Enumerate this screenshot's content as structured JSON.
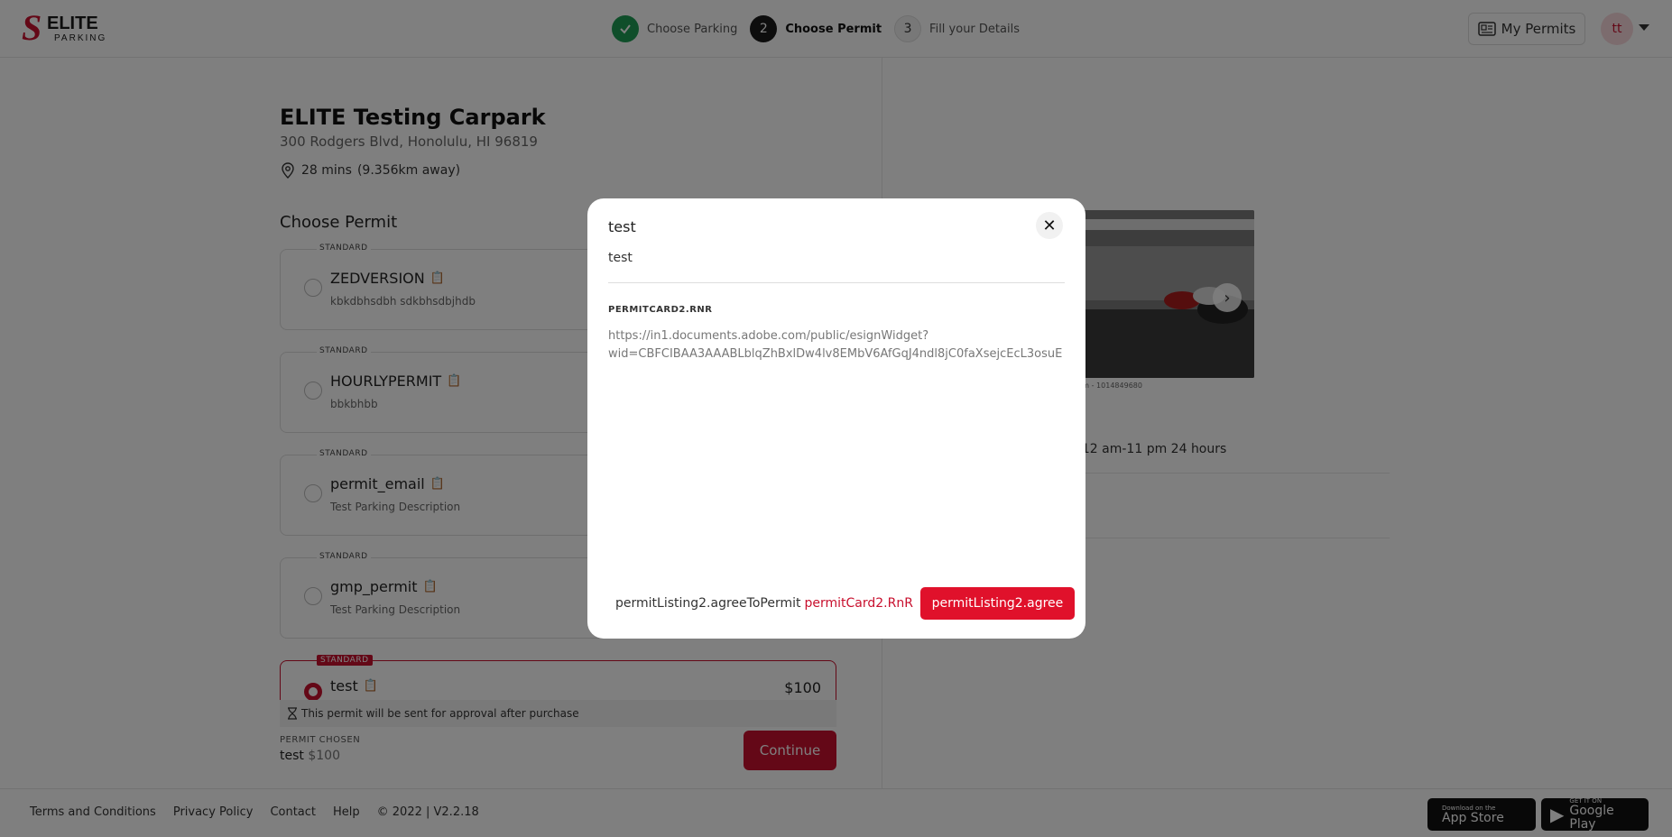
{
  "header": {
    "logo_text_primary": "ELITE",
    "logo_text_secondary": "PARKING",
    "steps": [
      {
        "number": "1",
        "label": "Choose Parking",
        "status": "done"
      },
      {
        "number": "2",
        "label": "Choose Permit",
        "status": "active"
      },
      {
        "number": "3",
        "label": "Fill your Details",
        "status": "todo"
      }
    ],
    "my_permits_label": "My Permits",
    "avatar_initials": "tt"
  },
  "carpark": {
    "name": "ELITE Testing Carpark",
    "address": "300 Rodgers Blvd, Honolulu, HI 96819",
    "duration": "28 mins",
    "distance": "(9.356km away)"
  },
  "choose_permit_title": "Choose Permit",
  "permits": [
    {
      "tag": "STANDARD",
      "name": "ZEDVERSION",
      "description": "kbkdbhsdbh sdkbhsdbjhdb",
      "price": "",
      "selected": false
    },
    {
      "tag": "STANDARD",
      "name": "HOURLYPERMIT",
      "description": "bbkbhbb",
      "price": "",
      "selected": false
    },
    {
      "tag": "STANDARD",
      "name": "permit_email",
      "description": "Test Parking Description",
      "price": "",
      "selected": false
    },
    {
      "tag": "STANDARD",
      "name": "gmp_permit",
      "description": "Test Parking Description",
      "price": "",
      "selected": false
    },
    {
      "tag": "STANDARD",
      "name": "test",
      "description": "",
      "price": "$100",
      "selected": true
    }
  ],
  "approval_notice": "This permit will be sent for approval after purchase",
  "permit_chosen": {
    "label": "PERMIT CHOSEN",
    "name": "test",
    "price": "$100"
  },
  "continue_label": "Continue",
  "side_panel": {
    "photo_credit": "com - 1014849680",
    "hours_text": ", 12 am-11 pm 24 hours"
  },
  "footer": {
    "links": [
      "Terms and Conditions",
      "Privacy Policy",
      "Contact",
      "Help"
    ],
    "copyright": "© 2022 | V2.2.18",
    "app_store": {
      "small": "Download on the",
      "big": "App Store"
    },
    "google_play": {
      "small": "GET IT ON",
      "big": "Google Play"
    }
  },
  "modal": {
    "title": "test",
    "subtitle": "test",
    "section_label": "PERMITCARD2.RNR",
    "url_line1": "https://in1.documents.adobe.com/public/esignWidget?",
    "url_line2": "wid=CBFCIBAA3AAABLblqZhBxlDw4lv8EMbV6AfGqJ4ndl8jC0faXsejcEcL3osuE",
    "agree_text": "permitListing2.agreeToPermit",
    "agree_link": "permitCard2.RnR",
    "agree_button": "permitListing2.agree"
  },
  "colors": {
    "brand_red": "#c8102e",
    "agree_red": "#e0112b",
    "step_done_green": "#1f9d55"
  },
  "icons": {
    "step_done": "check-icon",
    "location": "map-pin-icon",
    "copy": "clipboard-icon",
    "approval": "hourglass-icon",
    "close": "close-icon",
    "my_permits": "permit-card-icon",
    "carousel_next": "chevron-right-icon"
  }
}
